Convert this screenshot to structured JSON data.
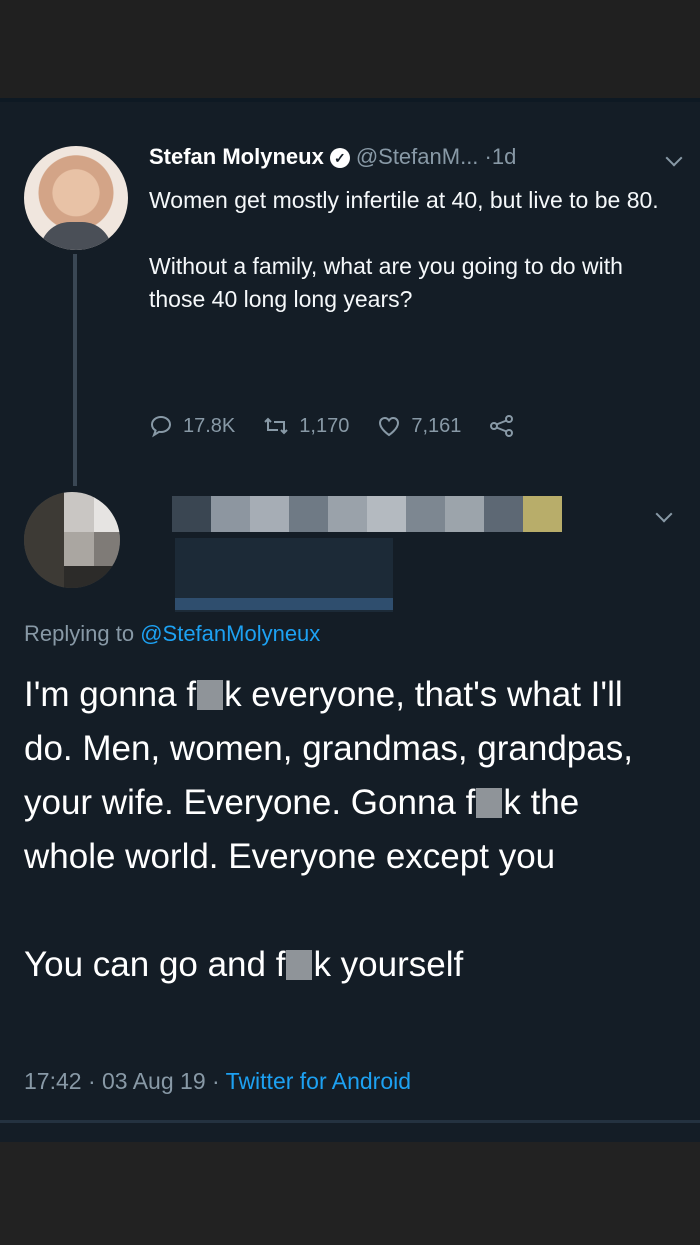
{
  "original_tweet": {
    "display_name": "Stefan Molyneux",
    "handle": "@StefanM...",
    "separator": "·",
    "age": "1d",
    "paragraphs": [
      "Women get mostly infertile at 40, but live to be 80.",
      "Without a family, what are you going to do with those 40 long long years?"
    ],
    "stats": {
      "replies": "17.8K",
      "retweets": "1,170",
      "likes": "7,161"
    }
  },
  "reply": {
    "replying_prefix": "Replying to",
    "replying_to": "@StefanMolyneux",
    "lines": [
      {
        "before": "I'm gonna f",
        "after": "k everyone, that's what I'll do. Men, women, grandmas, grandpas, your wife. Everyone. Gonna f",
        "after2": "k the whole world. Everyone except you"
      },
      {
        "before": "You can go and f",
        "after": "k yourself"
      }
    ],
    "time": "17:42",
    "separator": "·",
    "date": "03 Aug 19",
    "separator2": "·",
    "source": "Twitter for Android"
  },
  "colors": {
    "background": "#141d26",
    "muted": "#8899a6",
    "accent": "#1da1f2"
  }
}
